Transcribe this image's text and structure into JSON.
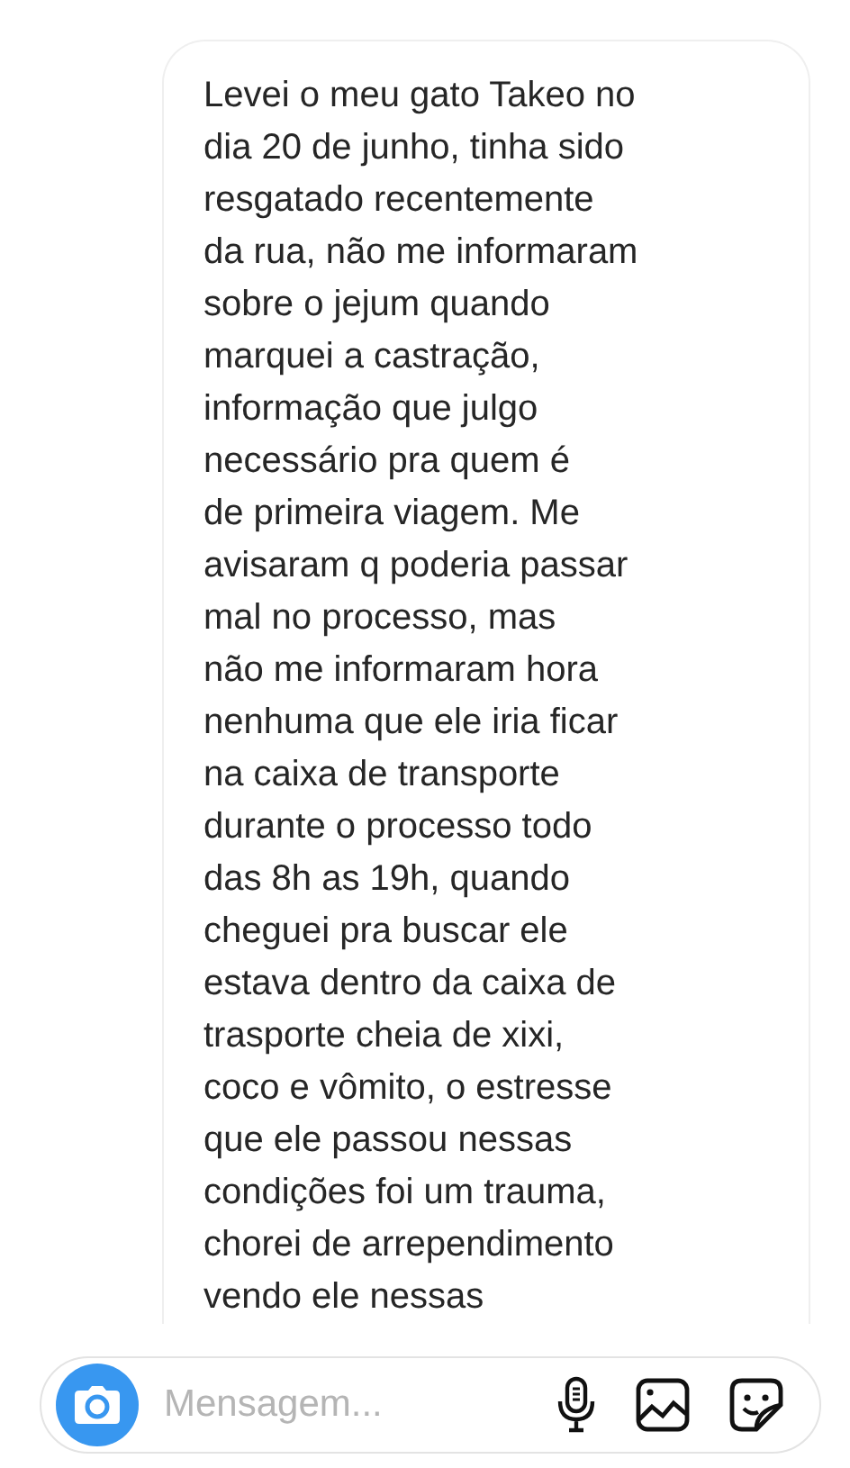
{
  "message": {
    "lines": [
      "Levei o meu gato Takeo no",
      "dia 20 de junho, tinha sido",
      "resgatado recentemente",
      "da rua, não me informaram",
      "sobre o jejum quando",
      "marquei a castração,",
      "informação que julgo",
      "necessário pra quem é",
      "de primeira viagem. Me",
      "avisaram q poderia passar",
      "mal no processo, mas",
      "não me informaram hora",
      "nenhuma que ele iria ficar",
      "na caixa de transporte",
      "durante o processo todo",
      "das 8h as 19h, quando",
      "cheguei pra buscar ele",
      "estava dentro da caixa de",
      "trasporte cheia de xixi,",
      "coco e vômito, o estresse",
      "que ele passou nessas",
      "condições foi um trauma,",
      "chorei de arrependimento",
      "vendo ele nessas"
    ]
  },
  "composer": {
    "placeholder": "Mensagem..."
  }
}
